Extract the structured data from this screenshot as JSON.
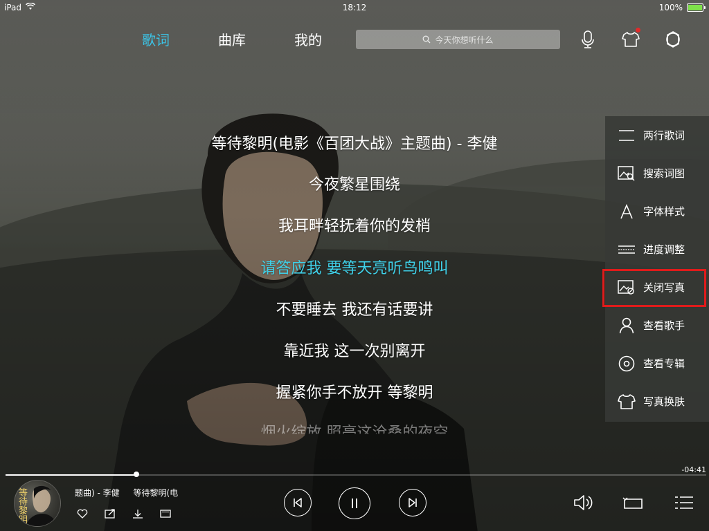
{
  "status_bar": {
    "device": "iPad",
    "time": "18:12",
    "battery": "100%"
  },
  "nav": {
    "tabs": [
      {
        "label": "歌词",
        "active": true
      },
      {
        "label": "曲库",
        "active": false
      },
      {
        "label": "我的",
        "active": false
      }
    ],
    "search_placeholder": "今天你想听什么",
    "icons": [
      "microphone-icon",
      "tshirt-skin-icon",
      "settings-gear-icon"
    ]
  },
  "lyrics": {
    "lines": [
      "等待黎明(电影《百团大战》主题曲) - 李健",
      "今夜繁星围绕",
      "我耳畔轻抚着你的发梢",
      "请答应我 要等天亮听鸟鸣叫",
      "不要睡去 我还有话要讲",
      "靠近我 这一次别离开",
      "握紧你手不放开 等黎明",
      "烟火绽放 照亮这沧桑的夜空"
    ],
    "current_index": 3
  },
  "side_menu": {
    "items": [
      {
        "label": "两行歌词",
        "icon": "two-lines-icon"
      },
      {
        "label": "搜索词图",
        "icon": "image-search-icon"
      },
      {
        "label": "字体样式",
        "icon": "font-a-icon"
      },
      {
        "label": "进度调整",
        "icon": "progress-adjust-icon"
      },
      {
        "label": "关闭写真",
        "icon": "image-close-icon",
        "highlighted": true
      },
      {
        "label": "查看歌手",
        "icon": "person-icon"
      },
      {
        "label": "查看专辑",
        "icon": "disc-icon"
      },
      {
        "label": "写真换肤",
        "icon": "tshirt-icon"
      }
    ]
  },
  "player": {
    "song_title": "题曲) - 李健",
    "album_text": "等待黎明(电",
    "remaining_time": "-04:41",
    "progress": 0.187,
    "cover_text": "等待黎明",
    "mini_actions": [
      "heart-icon",
      "share-icon",
      "download-icon",
      "mv-icon"
    ],
    "controls": [
      "previous-icon",
      "pause-icon",
      "next-icon"
    ],
    "right_icons": [
      "volume-icon",
      "loop-mode-icon",
      "playlist-icon"
    ]
  },
  "colors": {
    "accent": "#3cc3e6",
    "highlight_border": "#e01b1b",
    "badge": "#e32a2a"
  }
}
